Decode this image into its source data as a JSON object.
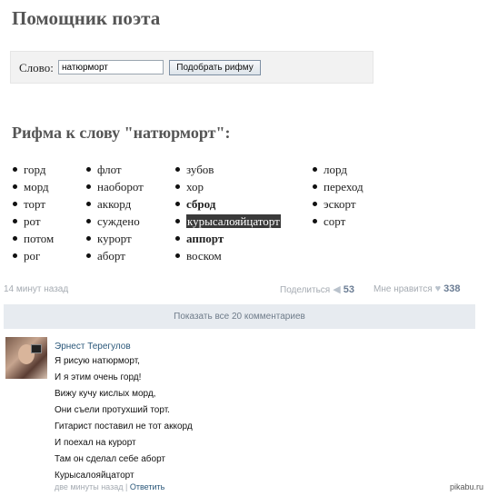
{
  "header": {
    "title": "Помощник поэта"
  },
  "search": {
    "label": "Слово:",
    "value": "натюрморт",
    "button_label": "Подобрать рифму"
  },
  "results": {
    "heading": "Рифма к слову \"натюрморт\":",
    "columns": [
      [
        {
          "text": "горд"
        },
        {
          "text": "морд"
        },
        {
          "text": "торт"
        },
        {
          "text": "рот"
        },
        {
          "text": "потом"
        },
        {
          "text": "рог"
        }
      ],
      [
        {
          "text": "флот"
        },
        {
          "text": "наоборот"
        },
        {
          "text": "аккорд"
        },
        {
          "text": "суждено"
        },
        {
          "text": "курорт"
        },
        {
          "text": "аборт"
        }
      ],
      [
        {
          "text": "зубов"
        },
        {
          "text": "хор"
        },
        {
          "text": "сброд"
        },
        {
          "text": "курысалояйцатор​т"
        },
        {
          "text": "аппорт"
        },
        {
          "text": "воском"
        }
      ],
      [
        {
          "text": "лорд"
        },
        {
          "text": "переход"
        },
        {
          "text": "эскорт"
        },
        {
          "text": "сорт"
        }
      ]
    ]
  },
  "post_meta": {
    "timestamp": "14 минут назад",
    "share_label": "Поделиться",
    "share_count": "53",
    "like_label": "Мне нравится",
    "like_count": "338"
  },
  "comments_bar": {
    "label": "Показать все 20 комментариев"
  },
  "comment": {
    "author": "Эрнест Терегулов",
    "lines": [
      "Я рисую натюрморт,",
      "И я этим очень горд!",
      "Вижу кучу кислых морд,",
      "Они съели протухший торт.",
      "Гитарист поставил не тот аккорд",
      "И поехал на курорт",
      "Там он сделал себе аборт",
      "Курысалояйцатор​т"
    ],
    "time": "две минуты назад",
    "separator": "|",
    "reply_label": "Ответить"
  },
  "watermark": "pikabu.ru"
}
